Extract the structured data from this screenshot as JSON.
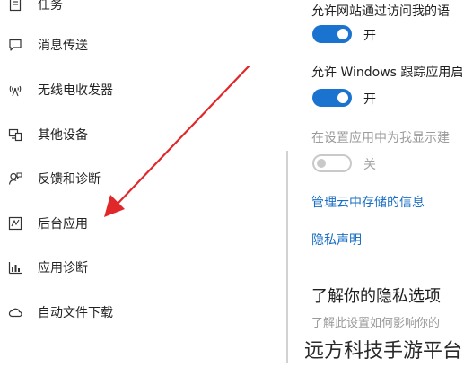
{
  "sidebar": {
    "items": [
      {
        "label": "任务",
        "icon": "clipboard-icon"
      },
      {
        "label": "消息传送",
        "icon": "chat-icon"
      },
      {
        "label": "无线电收发器",
        "icon": "antenna-icon"
      },
      {
        "label": "其他设备",
        "icon": "devices-icon"
      },
      {
        "label": "反馈和诊断",
        "icon": "feedback-icon"
      },
      {
        "label": "后台应用",
        "icon": "background-app-icon"
      },
      {
        "label": "应用诊断",
        "icon": "app-diagnostics-icon"
      },
      {
        "label": "自动文件下载",
        "icon": "cloud-icon"
      }
    ]
  },
  "settings": {
    "item1": {
      "text": "允许网站通过访问我的语",
      "state": "开"
    },
    "item2": {
      "text": "允许 Windows 跟踪应用启",
      "state": "开"
    },
    "item3": {
      "text": "在设置应用中为我显示建",
      "state": "关"
    }
  },
  "links": {
    "cloud_info": "管理云中存储的信息",
    "privacy_statement": "隐私声明"
  },
  "privacy_section": {
    "title": "了解你的隐私选项",
    "desc": "了解此设置如何影响你的"
  },
  "watermark": "远方科技手游平台",
  "colors": {
    "accent": "#1a73cf",
    "link": "#1a6fc4",
    "arrow": "#e0282a"
  }
}
